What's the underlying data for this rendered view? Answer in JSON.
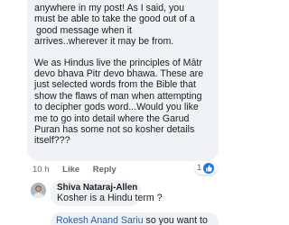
{
  "comment": {
    "lines": [
      "anywhere in my post!  As I said, you",
      "must be able to take the good out of a",
      "good message when it",
      "arrives..wherever it may be from.",
      "We as Hindus live the principles of Mātr",
      "devo bhava Pitr devo bhawa. These are",
      "just selected words from the Bible that",
      "show the flaws of man when attempting",
      "to decipher gods word...Would you like",
      "me to go into detail where the Garud",
      "Puran has some not so kosher details",
      "itself???"
    ],
    "time": "10 h",
    "like_label": "Like",
    "reply_label": "Reply",
    "reaction_count": "1"
  },
  "reply": {
    "author": "Shiva Nataraj-Allen",
    "text": "Kosher is a Hindu term ?"
  },
  "next_reply": {
    "mention": "Rokesh Anand Sariu",
    "text": " so you want to"
  },
  "colors": {
    "bubble": "#f0f2f5",
    "text": "#1c1e21",
    "meta": "#65676b",
    "like_blue": "#1877f2",
    "mention": "#385898"
  },
  "icons": {
    "reaction": "thumbs-up-icon",
    "avatar": "avatar"
  }
}
